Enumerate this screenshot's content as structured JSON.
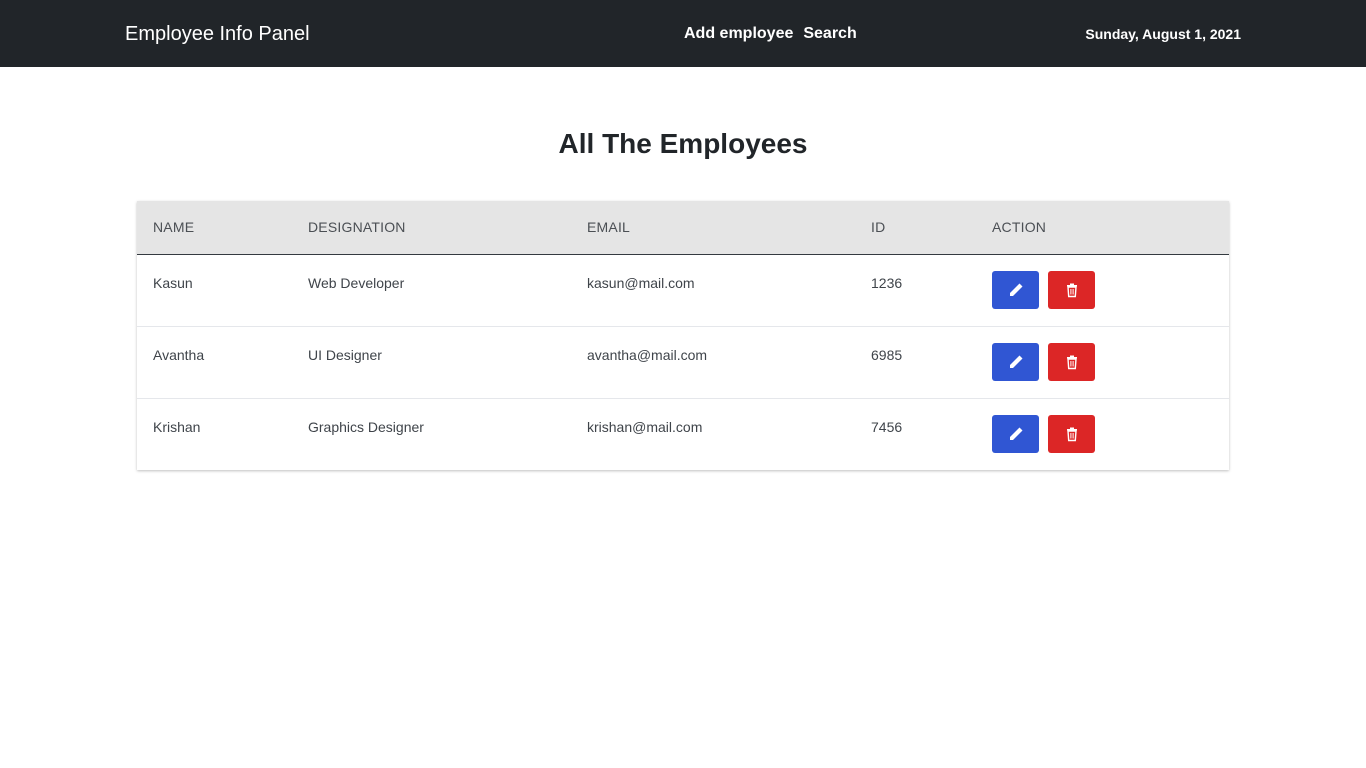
{
  "navbar": {
    "brand": "Employee Info Panel",
    "links": [
      "Add employee",
      "Search"
    ],
    "date": "Sunday, August 1, 2021"
  },
  "main": {
    "title": "All The Employees",
    "table": {
      "headers": [
        "NAME",
        "DESIGNATION",
        "EMAIL",
        "ID",
        "ACTION"
      ],
      "rows": [
        {
          "name": "Kasun",
          "designation": "Web Developer",
          "email": "kasun@mail.com",
          "id": "1236"
        },
        {
          "name": "Avantha",
          "designation": "UI Designer",
          "email": "avantha@mail.com",
          "id": "6985"
        },
        {
          "name": "Krishan",
          "designation": "Graphics Designer",
          "email": "krishan@mail.com",
          "id": "7456"
        }
      ],
      "actions": [
        {
          "icon": "pencil-icon",
          "color": "#3056d3"
        },
        {
          "icon": "trash-icon",
          "color": "#dc2626"
        }
      ]
    }
  }
}
